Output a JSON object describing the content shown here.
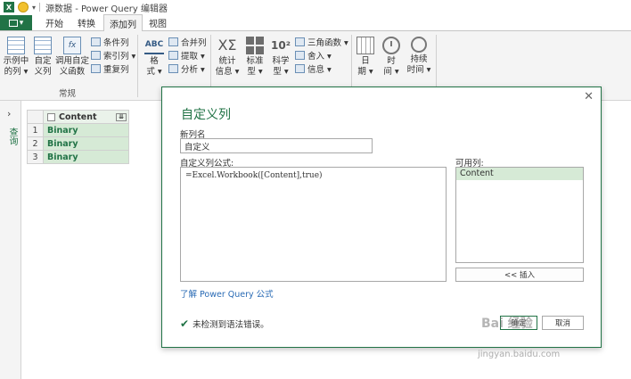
{
  "window": {
    "app_icon": "X",
    "title": "源数据 - Power Query 编辑器"
  },
  "tabs": {
    "file": "",
    "items": [
      "开始",
      "转换",
      "添加列",
      "视图"
    ],
    "active": "添加列"
  },
  "ribbon": {
    "col_from_examples": [
      "示例中",
      "的列 ▾"
    ],
    "custom_column": [
      "自定",
      "义列"
    ],
    "invoke_function": [
      "调用自定",
      "义函数"
    ],
    "conditional_column": "条件列",
    "index_column": "索引列 ▾",
    "duplicate_column": "重复列",
    "group_label": "常规",
    "format": [
      "格",
      "式 ▾"
    ],
    "merge_columns": "合并列",
    "extract": "提取 ▾",
    "parse": "分析 ▾",
    "statistics": [
      "统计",
      "信息 ▾"
    ],
    "standard": [
      "标准",
      "型 ▾"
    ],
    "scientific": [
      "科学",
      "型 ▾"
    ],
    "trig": "三角函数 ▾",
    "rounding": "舍入 ▾",
    "information": "信息 ▾",
    "date": [
      "日",
      "期 ▾"
    ],
    "time": [
      "时",
      "间 ▾"
    ],
    "duration": [
      "持续",
      "时间 ▾"
    ],
    "sigma_symbol": "XΣ",
    "power_symbol": "10²"
  },
  "navigator": {
    "label": "查询"
  },
  "grid": {
    "header": "Content",
    "expand_symbol": "⇊",
    "rows": [
      {
        "num": "1",
        "value": "Binary"
      },
      {
        "num": "2",
        "value": "Binary"
      },
      {
        "num": "3",
        "value": "Binary"
      }
    ]
  },
  "dialog": {
    "title": "自定义列",
    "close_symbol": "✕",
    "name_label": "新列名",
    "name_value": "自定义",
    "formula_label": "自定义列公式:",
    "formula_value": "=Excel.Workbook([Content],true)",
    "available_label": "可用列:",
    "available_columns": [
      "Content"
    ],
    "insert_button": "<< 插入",
    "learn_link": "了解 Power Query 公式",
    "status_text": "未检测到语法错误。",
    "ok_button": "确定",
    "cancel_button": "取消"
  },
  "watermark": {
    "text": "Bai 经验",
    "url": "jingyan.baidu.com"
  }
}
